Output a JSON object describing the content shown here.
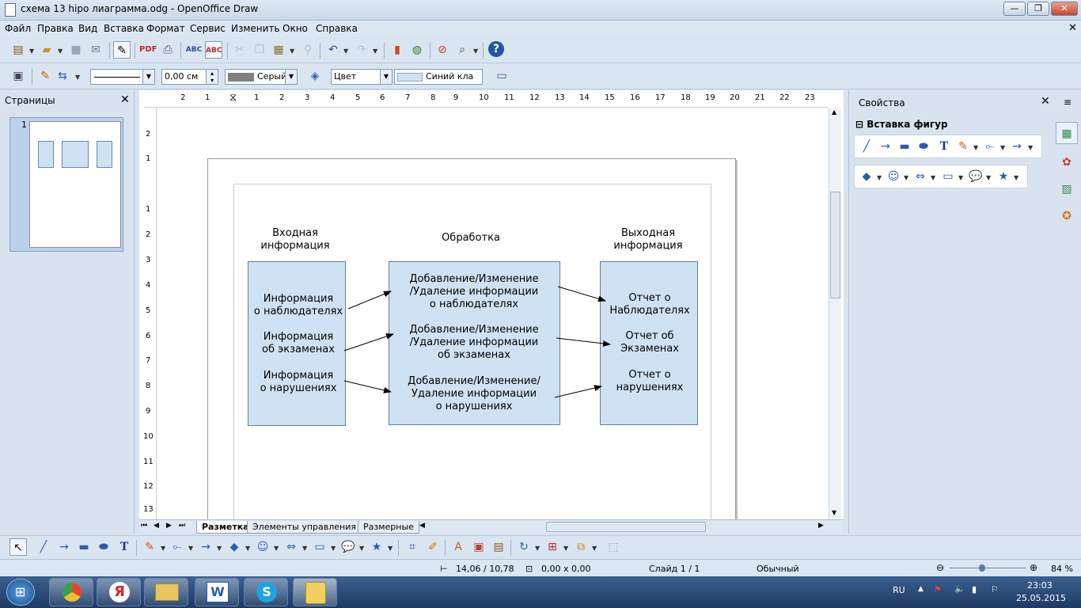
{
  "window": {
    "title": "схема 13 hipo лиаграмма.odg - OpenOffice Draw",
    "controls": {
      "minimize": "—",
      "maximize": "❐",
      "close": "✕"
    }
  },
  "menu": [
    "Файл",
    "Правка",
    "Вид",
    "Вставка",
    "Формат",
    "Сервис",
    "Изменить",
    "Окно",
    "Справка"
  ],
  "line_toolbar": {
    "width_value": "0,00 см",
    "line_color": "Серый",
    "area_style": "Цвет",
    "area_color": "Синий кла"
  },
  "pages_panel": {
    "title": "Страницы",
    "page_number": "1"
  },
  "ruler": {
    "h_ticks": [
      "2",
      "1",
      "1",
      "2",
      "3",
      "4",
      "5",
      "6",
      "7",
      "8",
      "9",
      "10",
      "11",
      "12",
      "13",
      "14",
      "15",
      "16",
      "17",
      "18",
      "19",
      "20",
      "21",
      "22",
      "23"
    ],
    "v_ticks": [
      "2",
      "1",
      "1",
      "2",
      "3",
      "4",
      "5",
      "6",
      "7",
      "8",
      "9",
      "10",
      "11",
      "12",
      "13"
    ]
  },
  "diagram": {
    "headers": {
      "input": "Входная\nинформация",
      "process": "Обработка",
      "output": "Выходная\nинформация"
    },
    "input_items": [
      "Информация\nо наблюдателях",
      "Информация\nоб экзаменах",
      "Информация\nо нарушениях"
    ],
    "process_items": [
      "Добавление/Изменение\n/Удаление  информации\nо наблюдателях",
      "Добавление/Изменение\n/Удаление информации\nоб экзаменах",
      "Добавление/Изменение/\nУдаление информации\nо нарушениях"
    ],
    "output_items": [
      "Отчет о\nНаблюдателях",
      "Отчет об\nЭкзаменах",
      "Отчет о\nнарушениях"
    ],
    "colors": {
      "box_fill": "#cfe2f3",
      "box_border": "#5f7f9f"
    }
  },
  "sheet_tabs": [
    "Разметка",
    "Элементы управления",
    "Размерные"
  ],
  "properties_panel": {
    "title": "Свойства",
    "section": "Вставка фигур"
  },
  "status": {
    "position": "14,06 / 10,78",
    "size": "0,00 x 0,00",
    "slide": "Слайд 1 / 1",
    "layout": "Обычный",
    "zoom": "84 %",
    "zoom_level": 0.42
  },
  "taskbar": {
    "lang": "RU",
    "time": "23:03",
    "date": "25.05.2015"
  }
}
